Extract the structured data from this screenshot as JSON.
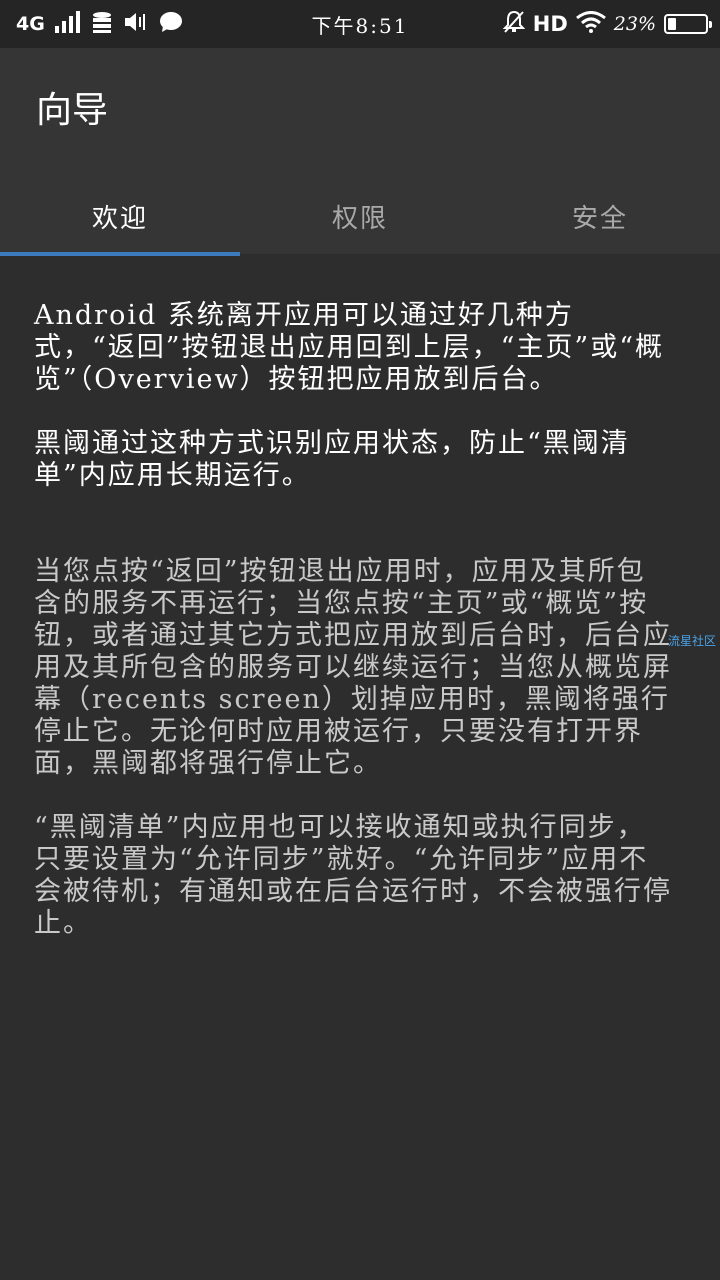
{
  "status_bar": {
    "network": "4G",
    "time": "下午8:51",
    "hd": "HD",
    "battery_text": "23%",
    "battery_level": 0.23
  },
  "app_bar": {
    "title": "向导",
    "tabs": [
      {
        "label": "欢迎",
        "active": true
      },
      {
        "label": "权限",
        "active": false
      },
      {
        "label": "安全",
        "active": false
      }
    ],
    "accent_color": "#3d7bbf"
  },
  "content": {
    "paragraphs": [
      "Android 系统离开应用可以通过好几种方式，“返回”按钮退出应用回到上层，“主页”或“概览”（Overview）按钮把应用放到后台。",
      "黑阈通过这种方式识别应用状态，防止“黑阈清单”内应用长期运行。",
      "当您点按“返回”按钮退出应用时，应用及其所包含的服务不再运行；当您点按“主页”或“概览”按钮，或者通过其它方式把应用放到后台时，后台应用及其所包含的服务可以继续运行；当您从概览屏幕（recents screen）划掉应用时，黑阈将强行停止它。无论何时应用被运行，只要没有打开界面，黑阈都将强行停止它。",
      "“黑阈清单”内应用也可以接收通知或执行同步，只要设置为“允许同步”就好。“允许同步”应用不会被待机；有通知或在后台运行时，不会被强行停止。"
    ]
  },
  "watermark": "流星社区"
}
